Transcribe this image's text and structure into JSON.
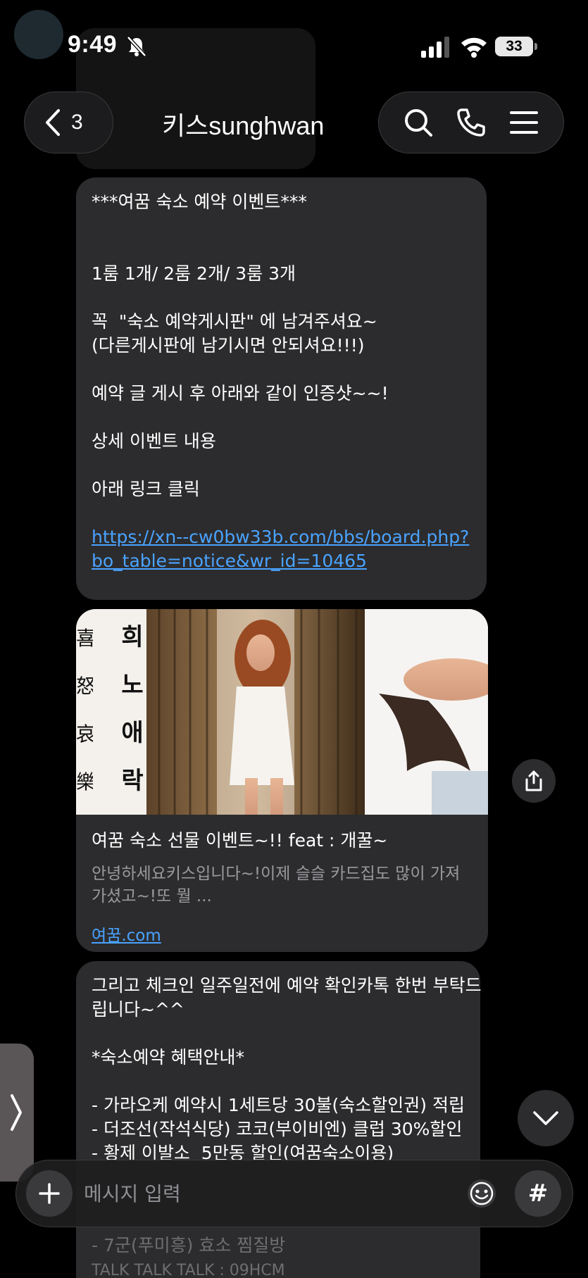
{
  "status_bar": {
    "time": "9:49",
    "battery": "33"
  },
  "header": {
    "back_count": "3",
    "title": "키스sunghwan"
  },
  "messages": {
    "event": {
      "lines": [
        "***여꿈 숙소 예약 이벤트***",
        "",
        "",
        "1룸 1개/ 2룸 2개/ 3룸 3개",
        "",
        "꼭  \"숙소 예약게시판\" 에 남겨주셔요~",
        "(다른게시판에 남기시면 안되셔요!!!)",
        "",
        "예약 글 게시 후 아래와 같이 인증샷~~!",
        "",
        "상세 이벤트 내용",
        "",
        "아래 링크 클릭",
        ""
      ],
      "link_line1": "https://xn--cw0bw33b.com/bbs/board.php?",
      "link_line2": "bo_table=notice&wr_id=10465"
    },
    "link_card": {
      "title": "여꿈 숙소 선물 이벤트~!! feat : 개꿀~",
      "description": "안녕하세요키스입니다~!이제 슬슬 카드집도 많이 가져가셨고~!또 뭘 ...",
      "domain": "여꿈.com",
      "image_chars_left": [
        "喜",
        "怒",
        "哀",
        "樂"
      ],
      "image_chars_right": [
        "희",
        "노",
        "애",
        "락"
      ]
    },
    "benefits": {
      "lines": [
        "그리고 체크인 일주일전에 예약 확인카톡 한번 부탁드",
        "립니다~^^",
        "",
        "*숙소예약 혜택안내*",
        "",
        "- 가라오케 예약시 1세트당 30불(숙소할인권) 적립",
        "- 더조선(작석식당) 코코(부이비엔) 클럽 30%할인",
        "- 황제 이발소  5만동 할인(여꿈숙소이용)"
      ],
      "below_lines": [
        "- 7군(푸미흥) 효소 찜질방",
        "TALK TALK TALK : 09HCM"
      ]
    }
  },
  "input": {
    "placeholder": "메시지 입력"
  }
}
